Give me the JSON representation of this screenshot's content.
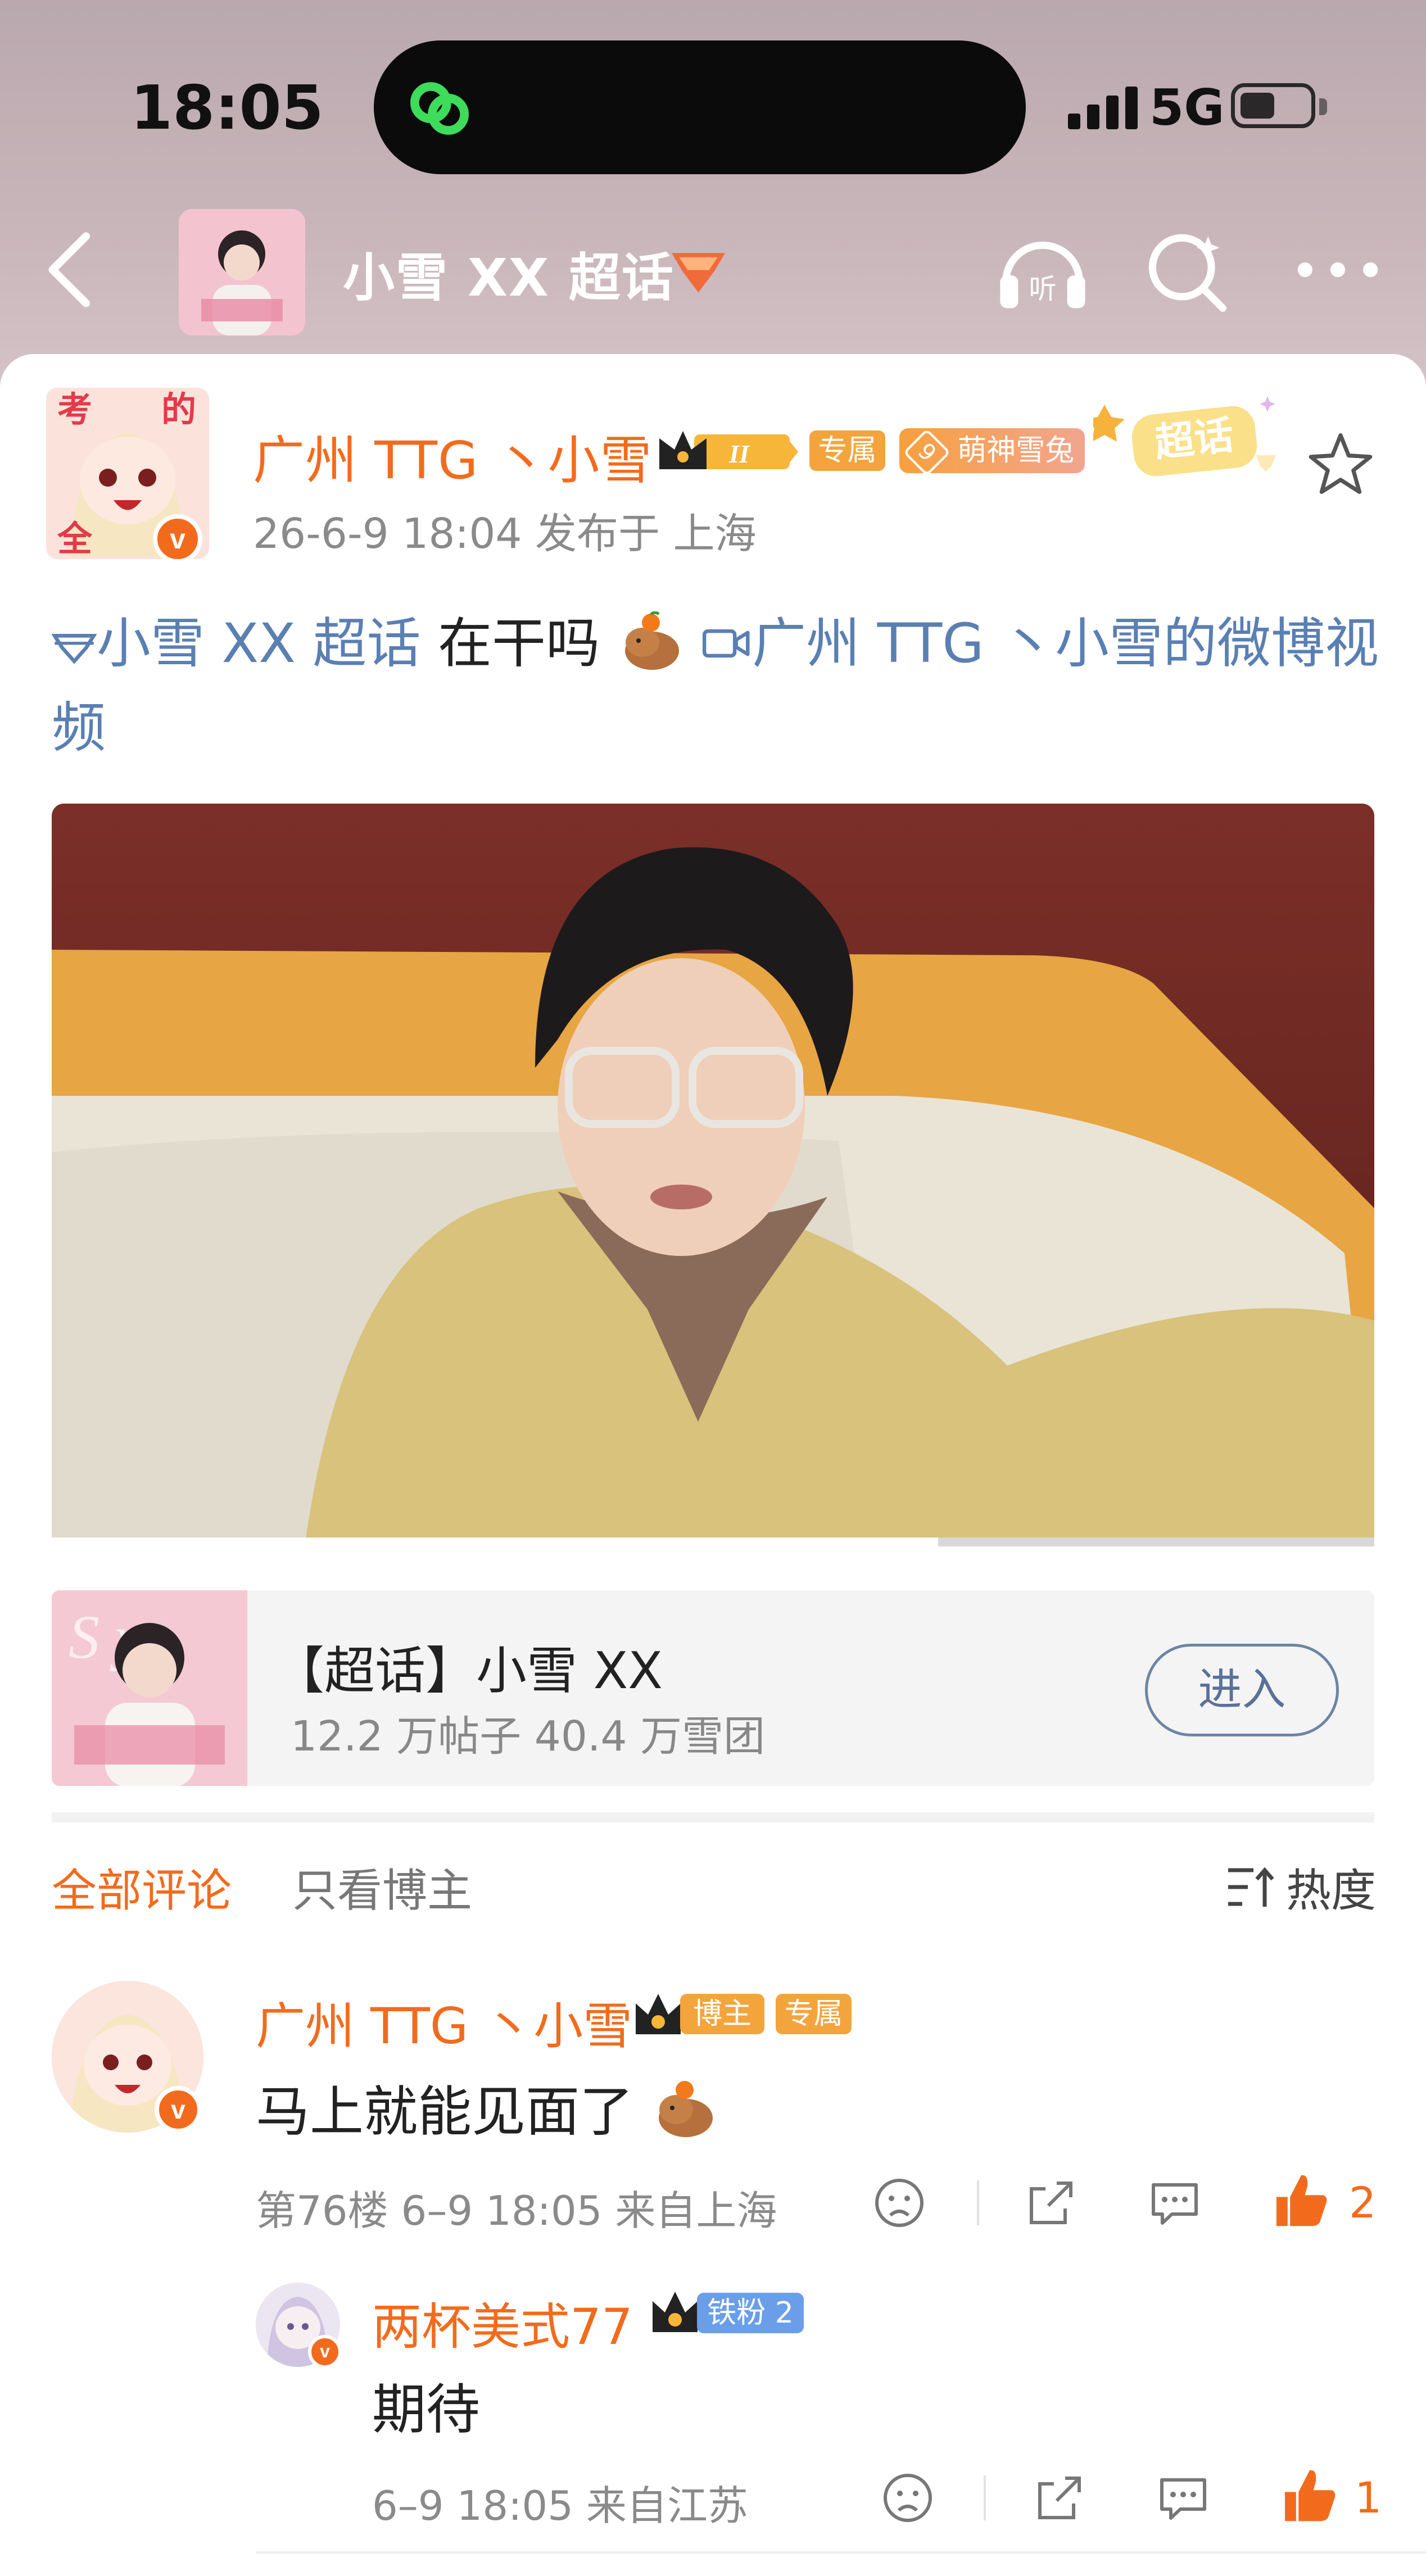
{
  "status_bar": {
    "time": "18:05",
    "network": "5G"
  },
  "header": {
    "title": "小雪 XX 超话"
  },
  "post": {
    "author": "广州 TTG 丶小雪",
    "tag_exclusive": "专属",
    "tag_fan": "萌神雪兔",
    "tag_fan_level": "9",
    "crown_level": "II",
    "chaohua_label": "超话",
    "meta": "26-6-9 18:04  发布于 上海",
    "text_topic": "小雪 XX 超话",
    "text_body": " 在干吗",
    "text_video_link": "广州 TTG 丶小雪的微博视频",
    "video_progress": 0.67
  },
  "topic_card": {
    "title": "【超话】小雪 XX",
    "stats": "12.2 万帖子 40.4 万雪团",
    "enter_label": "进入"
  },
  "comments_tabs": {
    "all": "全部评论",
    "author_only": "只看博主",
    "sort": "热度"
  },
  "comments": [
    {
      "name": "广州 TTG 丶小雪",
      "badge_role": "博主",
      "badge_exclusive": "专属",
      "text": "马上就能见面了",
      "meta": "第76楼 6–9 18:05  来自上海",
      "likes": "2"
    },
    {
      "name": "两杯美式77",
      "badge_fan": "铁粉 2",
      "text": "期待",
      "meta": "6–9 18:05  来自江苏",
      "likes": "1"
    }
  ],
  "colors": {
    "accent": "#f26b1d",
    "link": "#5a7fb3"
  }
}
